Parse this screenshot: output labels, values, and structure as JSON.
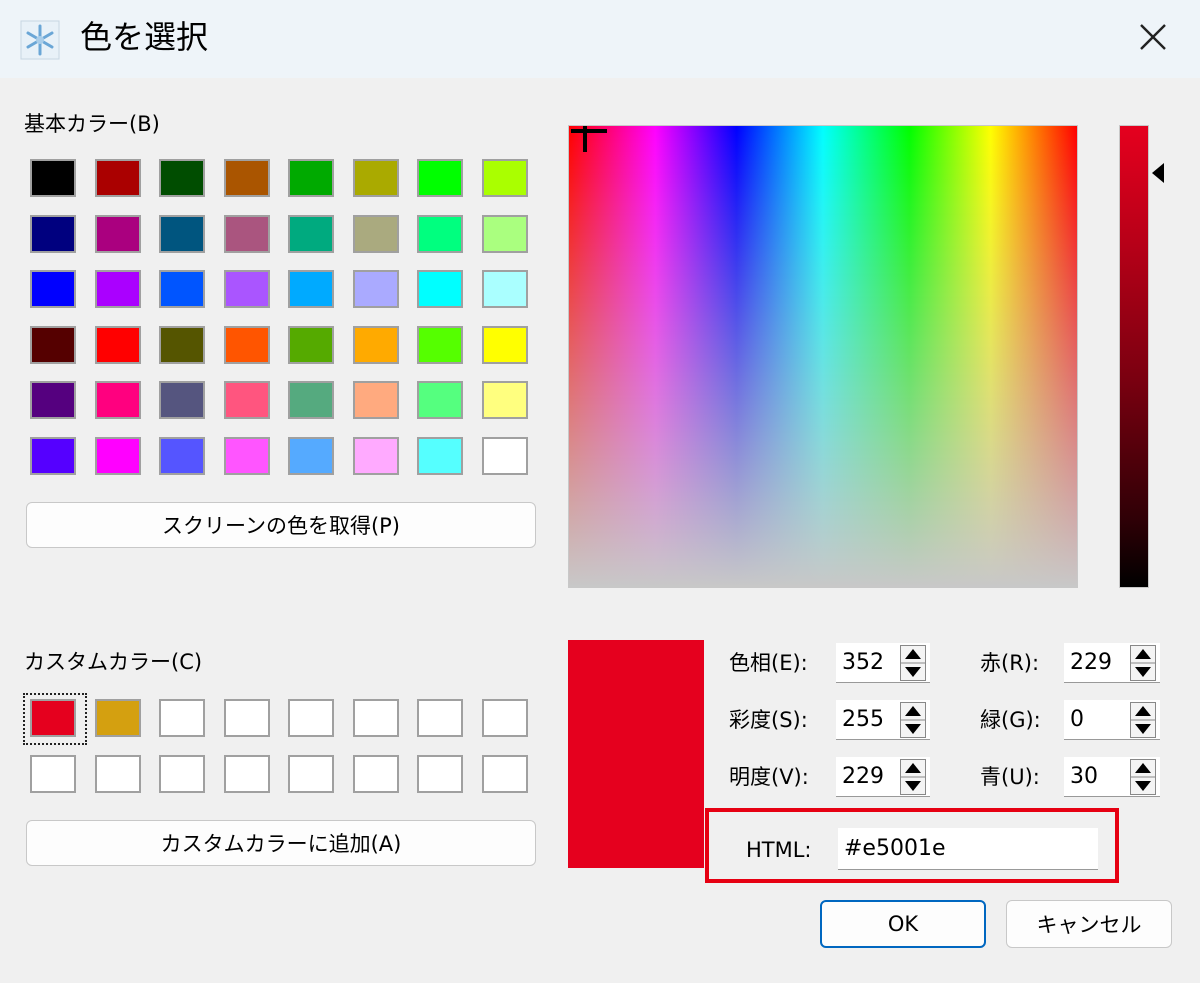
{
  "window": {
    "title": "色を選択"
  },
  "basic_colors": {
    "label": "基本カラー(B)",
    "swatches": [
      "#000000",
      "#aa0000",
      "#004d00",
      "#aa5500",
      "#00aa00",
      "#aaaa00",
      "#00ff00",
      "#aaff00",
      "#00007f",
      "#aa007f",
      "#00557f",
      "#aa557f",
      "#00aa7f",
      "#aaaa7f",
      "#00ff7f",
      "#aaff7f",
      "#0000ff",
      "#aa00ff",
      "#0055ff",
      "#aa55ff",
      "#00aaff",
      "#aaaaff",
      "#00ffff",
      "#aaffff",
      "#550000",
      "#ff0000",
      "#555500",
      "#ff5500",
      "#55aa00",
      "#ffaa00",
      "#55ff00",
      "#ffff00",
      "#55007f",
      "#ff007f",
      "#55557f",
      "#ff557f",
      "#55aa7f",
      "#ffaa7f",
      "#55ff7f",
      "#ffff7f",
      "#5500ff",
      "#ff00ff",
      "#5555ff",
      "#ff55ff",
      "#55aaff",
      "#ffaaff",
      "#55ffff",
      "#ffffff"
    ]
  },
  "pick_screen_button": "スクリーンの色を取得(P)",
  "custom_colors": {
    "label": "カスタムカラー(C)",
    "swatches": [
      "#e5001e",
      "#d4a010",
      "",
      "",
      "",
      "",
      "",
      "",
      "",
      "",
      "",
      "",
      "",
      "",
      "",
      ""
    ]
  },
  "add_custom_button": "カスタムカラーに追加(A)",
  "current_color": "#e5001e",
  "fields": {
    "hue": {
      "label": "色相(E):",
      "value": "352"
    },
    "sat": {
      "label": "彩度(S):",
      "value": "255"
    },
    "val": {
      "label": "明度(V):",
      "value": "229"
    },
    "red": {
      "label": "赤(R):",
      "value": "229"
    },
    "green": {
      "label": "緑(G):",
      "value": "0"
    },
    "blue": {
      "label": "青(U):",
      "value": "30"
    }
  },
  "html": {
    "label": "HTML:",
    "value": "#e5001e"
  },
  "ok_button": "OK",
  "cancel_button": "キャンセル"
}
